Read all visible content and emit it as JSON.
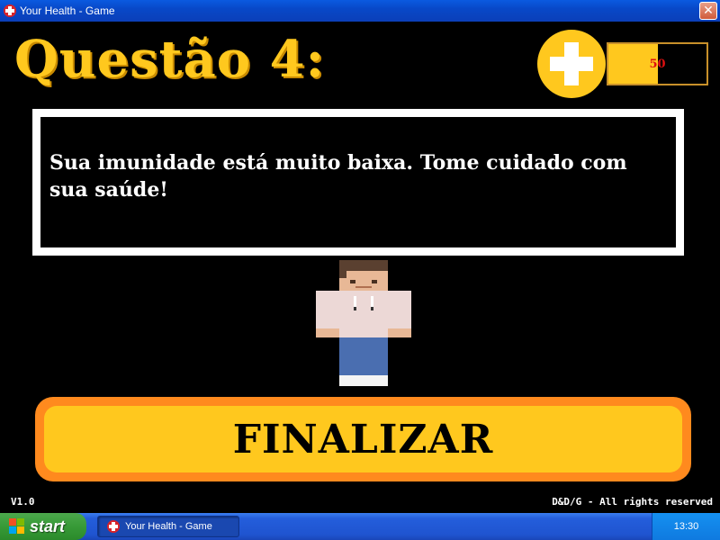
{
  "window": {
    "title": "Your Health - Game",
    "close_glyph": "✕",
    "icon": "health-cross-icon"
  },
  "game": {
    "question_title": "Questão 4:",
    "health": {
      "value_label": "50",
      "fill_fraction": 0.5,
      "icon": "health-cross-icon",
      "accent_color": "#ffc81e",
      "value_color": "#e01010"
    },
    "message": "Sua imunidade está muito baixa. Tome cuidado com sua saúde!",
    "finalize_label": "FINALIZAR",
    "version": "V1.0",
    "copyright": "D&D/G - All rights reserved"
  },
  "taskbar": {
    "start_label": "start",
    "task_label": "Your Health - Game",
    "clock": "13:30"
  },
  "colors": {
    "background": "#000000",
    "title_yellow": "#ffc81e",
    "button_orange": "#ff8a1e",
    "message_border": "#ffffff"
  }
}
